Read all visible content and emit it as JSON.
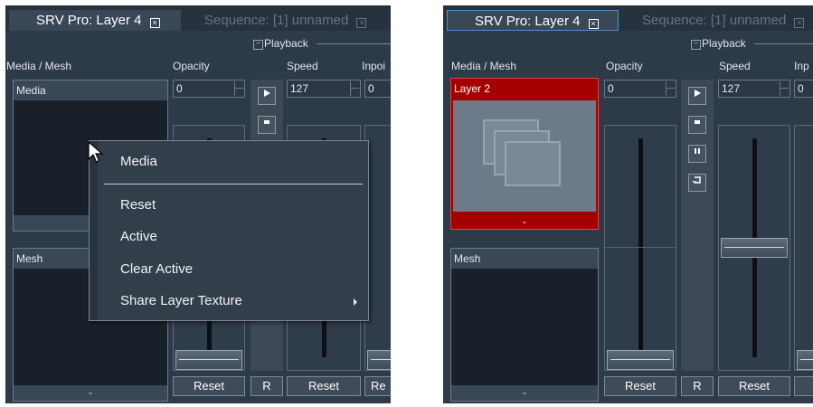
{
  "left": {
    "tab_active": "SRV Pro: Layer 4",
    "tab_inactive": "Sequence: [1] unnamed",
    "group_label": "Playback",
    "col_media_mesh": "Media / Mesh",
    "col_opacity": "Opacity",
    "col_speed": "Speed",
    "col_inpoint": "Inpoi",
    "media_title": "Media",
    "mesh_title": "Mesh",
    "mesh_footer": "-",
    "opacity_value": "0",
    "speed_value": "127",
    "inpoint_value": "0",
    "reset_label": "Reset",
    "r_label": "R",
    "reset_label_2": "Reset",
    "reset_label_3": "Re",
    "opacity_level": 0.0,
    "speed_level": 0.5
  },
  "context_menu": {
    "items": [
      "Media",
      "Reset",
      "Active",
      "Clear Active",
      "Share Layer Texture"
    ]
  },
  "right": {
    "tab_active": "SRV Pro: Layer 4",
    "tab_inactive": "Sequence: [1] unnamed",
    "group_label": "Playback",
    "col_media_mesh": "Media / Mesh",
    "col_opacity": "Opacity",
    "col_speed": "Speed",
    "col_inpoint": "Inp",
    "layer_title": "Layer 2",
    "layer_footer": "-",
    "mesh_title": "Mesh",
    "mesh_footer": "-",
    "opacity_value": "0",
    "speed_value": "127",
    "inpoint_value": "0",
    "reset_label": "Reset",
    "r_label": "R",
    "reset_label_2": "Reset",
    "opacity_level": 0.0,
    "speed_level": 0.5
  },
  "colors": {
    "panel_bg": "#2d3a48",
    "selected_layer": "#a40000",
    "thumb_bg": "#6c7a8a"
  },
  "icons": [
    "play-icon",
    "stop-icon",
    "pause-icon",
    "loop-icon",
    "close-tab-icon",
    "collapse-icon",
    "submenu-arrow-icon",
    "mouse-cursor-icon",
    "layer-stack-icon"
  ]
}
